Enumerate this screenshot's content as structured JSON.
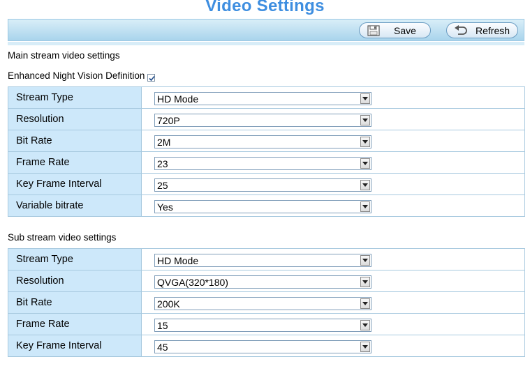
{
  "page_title": "Video Settings",
  "toolbar": {
    "save_label": "Save",
    "refresh_label": "Refresh"
  },
  "main_stream": {
    "heading": "Main stream video settings",
    "night_vision_label": "Enhanced Night Vision Definition",
    "night_vision_checked": true,
    "rows": [
      {
        "label": "Stream Type",
        "value": "HD Mode"
      },
      {
        "label": "Resolution",
        "value": "720P"
      },
      {
        "label": "Bit Rate",
        "value": "2M"
      },
      {
        "label": "Frame Rate",
        "value": "23"
      },
      {
        "label": "Key Frame Interval",
        "value": "25"
      },
      {
        "label": "Variable bitrate",
        "value": "Yes"
      }
    ]
  },
  "sub_stream": {
    "heading": "Sub stream video settings",
    "rows": [
      {
        "label": "Stream Type",
        "value": "HD Mode"
      },
      {
        "label": "Resolution",
        "value": "QVGA(320*180)"
      },
      {
        "label": "Bit Rate",
        "value": "200K"
      },
      {
        "label": "Frame Rate",
        "value": "15"
      },
      {
        "label": "Key Frame Interval",
        "value": "45"
      }
    ]
  },
  "colors": {
    "title": "#3e8ee0",
    "label_cell_bg": "#cde8fa",
    "border": "#a7c9df"
  }
}
